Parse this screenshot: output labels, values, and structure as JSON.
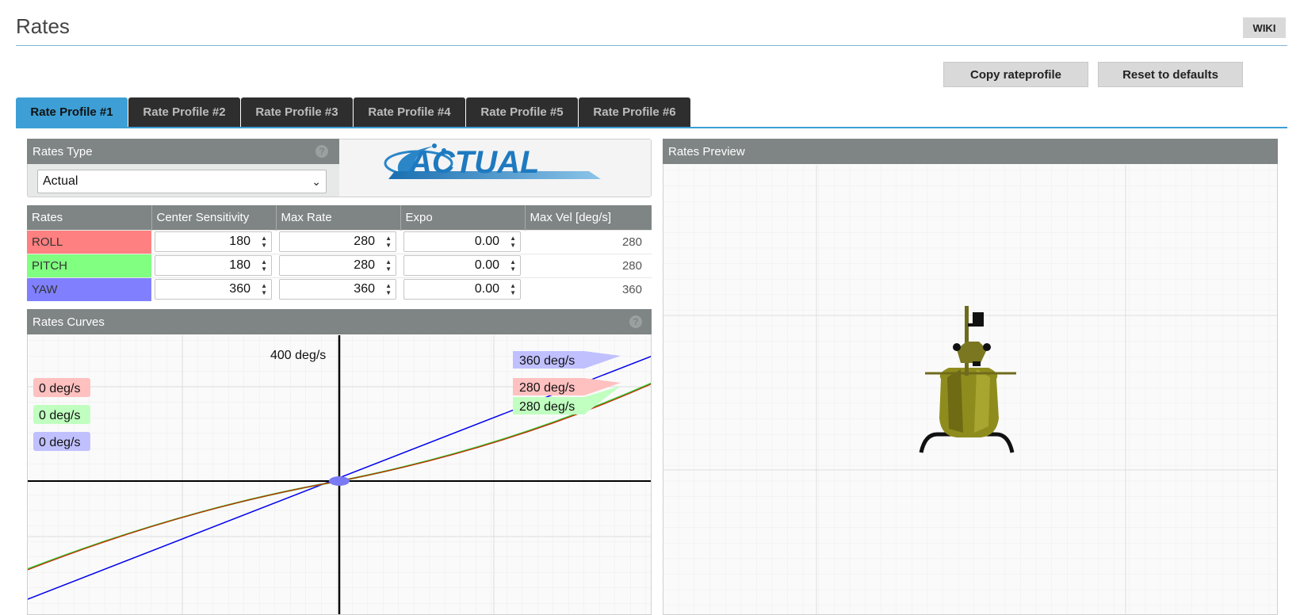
{
  "header": {
    "title": "Rates",
    "wiki_label": "WIKI"
  },
  "actions": {
    "copy_label": "Copy rateprofile",
    "reset_label": "Reset to defaults"
  },
  "tabs": [
    {
      "label": "Rate Profile #1",
      "active": true
    },
    {
      "label": "Rate Profile #2"
    },
    {
      "label": "Rate Profile #3"
    },
    {
      "label": "Rate Profile #4"
    },
    {
      "label": "Rate Profile #5"
    },
    {
      "label": "Rate Profile #6"
    }
  ],
  "rates_type": {
    "title": "Rates Type",
    "selected": "Actual",
    "help": "?",
    "logo_text": "ACTUAL"
  },
  "rates_table": {
    "headers": [
      "Rates",
      "Center Sensitivity",
      "Max Rate",
      "Expo",
      "Max Vel [deg/s]"
    ],
    "rows": [
      {
        "axis": "ROLL",
        "center": "180",
        "max_rate": "280",
        "expo": "0.00",
        "max_vel": "280",
        "color": "#ff8080"
      },
      {
        "axis": "PITCH",
        "center": "180",
        "max_rate": "280",
        "expo": "0.00",
        "max_vel": "280",
        "color": "#80ff80"
      },
      {
        "axis": "YAW",
        "center": "360",
        "max_rate": "360",
        "expo": "0.00",
        "max_vel": "360",
        "color": "#8080ff"
      }
    ]
  },
  "curves": {
    "title": "Rates Curves",
    "help": "?",
    "top_label": "400 deg/s",
    "current_labels": [
      "0 deg/s",
      "0 deg/s",
      "0 deg/s"
    ],
    "max_labels": {
      "yaw": "360 deg/s",
      "roll": "280 deg/s",
      "pitch": "280 deg/s"
    },
    "colors": {
      "roll": "#cc2200",
      "pitch": "#33cc33",
      "yaw": "#0000ee"
    }
  },
  "preview": {
    "title": "Rates Preview"
  }
}
